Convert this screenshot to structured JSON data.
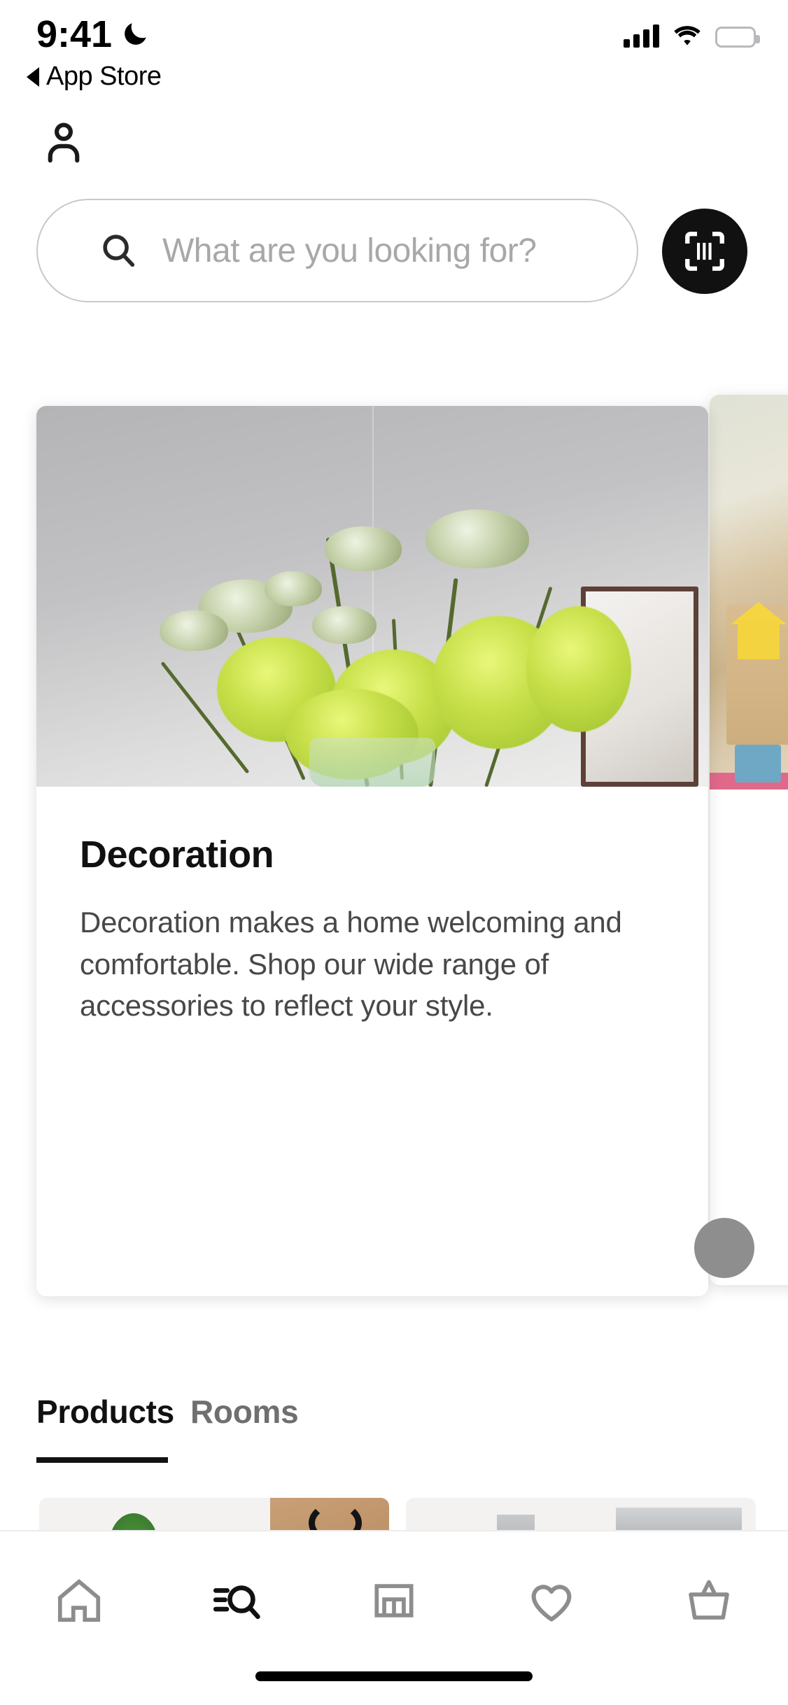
{
  "status_bar": {
    "time": "9:41",
    "dnd_icon": "moon-icon",
    "back_label": "App Store",
    "back_icon": "triangle-left-icon",
    "cellular_icon": "cellular-signal-icon",
    "wifi_icon": "wifi-icon",
    "battery_icon": "battery-full-icon"
  },
  "header": {
    "profile_icon": "person-icon"
  },
  "search": {
    "placeholder": "What are you looking for?",
    "search_icon": "search-icon",
    "scan_icon": "barcode-scan-icon",
    "scan_button_color": "#111111"
  },
  "carousel": {
    "cards": [
      {
        "title": "Decoration",
        "description": "Decoration makes a home welcoming and comfortable. Shop our wide range of accessories to reflect your style.",
        "image_alt": "green-flowers-in-vase"
      },
      {
        "title": "",
        "description": "",
        "image_alt": "childrens-room-with-toys"
      }
    ],
    "scroll_affordance": "scroll-next-dot"
  },
  "tabs": {
    "items": [
      {
        "label": "Products",
        "active": true
      },
      {
        "label": "Rooms",
        "active": false
      }
    ]
  },
  "bottom_nav": {
    "items": [
      {
        "label": "Home",
        "icon": "home-icon",
        "active": false
      },
      {
        "label": "Browse",
        "icon": "browse-search-icon",
        "active": true
      },
      {
        "label": "Stores",
        "icon": "store-icon",
        "active": false
      },
      {
        "label": "Favourites",
        "icon": "heart-icon",
        "active": false
      },
      {
        "label": "Cart",
        "icon": "basket-icon",
        "active": false
      }
    ],
    "active_color": "#111111",
    "inactive_color": "#8d8d8d"
  },
  "home_indicator": "home-indicator-bar"
}
